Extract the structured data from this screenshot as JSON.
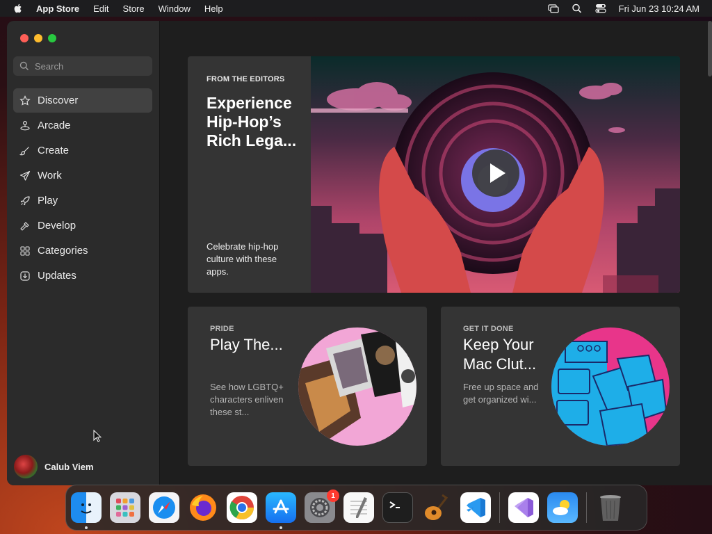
{
  "menubar": {
    "app_name": "App Store",
    "menus": [
      "Edit",
      "Store",
      "Window",
      "Help"
    ],
    "clock": "Fri Jun 23  10:24 AM"
  },
  "sidebar": {
    "search_placeholder": "Search",
    "items": [
      {
        "label": "Discover",
        "icon": "star-icon",
        "active": true
      },
      {
        "label": "Arcade",
        "icon": "joystick-icon"
      },
      {
        "label": "Create",
        "icon": "paintbrush-icon"
      },
      {
        "label": "Work",
        "icon": "paperplane-icon"
      },
      {
        "label": "Play",
        "icon": "rocket-icon"
      },
      {
        "label": "Develop",
        "icon": "hammer-icon"
      },
      {
        "label": "Categories",
        "icon": "grid-icon"
      },
      {
        "label": "Updates",
        "icon": "download-icon"
      }
    ],
    "user_name": "Calub Viem"
  },
  "hero": {
    "eyebrow": "FROM THE EDITORS",
    "title": "Experience Hip-Hop’s Rich Lega...",
    "description": "Celebrate hip-hop culture with these apps."
  },
  "cards": [
    {
      "eyebrow": "PRIDE",
      "title": "Play The...",
      "description": "See how LGBTQ+ characters enliven these st..."
    },
    {
      "eyebrow": "GET IT DONE",
      "title": "Keep Your Mac Clut...",
      "description": "Free up space and get organized wi..."
    }
  ],
  "dock": {
    "apps": [
      {
        "name": "Finder",
        "icon": "finder-icon",
        "running": true
      },
      {
        "name": "Launchpad",
        "icon": "launchpad-icon"
      },
      {
        "name": "Safari",
        "icon": "safari-icon"
      },
      {
        "name": "Firefox",
        "icon": "firefox-icon"
      },
      {
        "name": "Chrome",
        "icon": "chrome-icon"
      },
      {
        "name": "App Store",
        "icon": "app-store-icon",
        "running": true
      },
      {
        "name": "System Settings",
        "icon": "settings-icon",
        "badge": "1"
      },
      {
        "name": "TextEdit",
        "icon": "textedit-icon"
      },
      {
        "name": "Terminal",
        "icon": "terminal-icon"
      },
      {
        "name": "GarageBand",
        "icon": "garageband-icon"
      },
      {
        "name": "Visual Studio Code",
        "icon": "vscode-icon"
      },
      {
        "name": "Visual Studio",
        "icon": "visual-studio-icon"
      },
      {
        "name": "Weather",
        "icon": "weather-icon"
      },
      {
        "name": "Trash",
        "icon": "trash-icon"
      }
    ]
  }
}
